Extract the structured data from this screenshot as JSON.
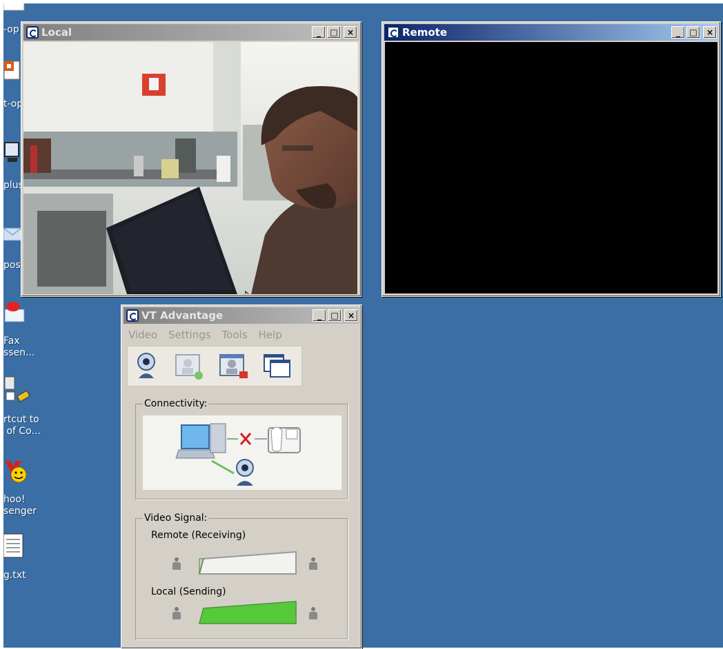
{
  "desktop": {
    "icons": [
      {
        "id": "doc",
        "label": "-op"
      },
      {
        "id": "ppt",
        "label": "t-op"
      },
      {
        "id": "monitor",
        "label": "plus"
      },
      {
        "id": "mail",
        "label": "pose"
      },
      {
        "id": "fax",
        "label": "Fax\nssen..."
      },
      {
        "id": "shortcut",
        "label": "rtcut to\n of Co..."
      },
      {
        "id": "yahoo",
        "label": "hoo!\nsenger"
      },
      {
        "id": "txt",
        "label": "g.txt"
      }
    ]
  },
  "local_window": {
    "title": "Local",
    "buttons": {
      "min": "_",
      "max": "□",
      "close": "×"
    }
  },
  "remote_window": {
    "title": "Remote",
    "buttons": {
      "min": "_",
      "max": "□",
      "close": "×"
    }
  },
  "vt_window": {
    "title": "VT Advantage",
    "buttons": {
      "min": "_",
      "max": "□",
      "close": "×"
    },
    "menu": [
      "Video",
      "Settings",
      "Tools",
      "Help"
    ],
    "toolbar": [
      "camera-icon",
      "add-video-icon",
      "stop-video-icon",
      "windows-icon"
    ],
    "connectivity": {
      "legend": "Connectivity:",
      "status_icons": [
        "computer-icon",
        "disconnected-x-icon",
        "ip-phone-icon",
        "camera-icon"
      ]
    },
    "video_signal": {
      "legend": "Video Signal:",
      "remote_label": "Remote (Receiving)",
      "local_label": "Local (Sending)",
      "remote_level": 0,
      "local_level": 1
    }
  },
  "colors": {
    "desktop": "#3a6ea5",
    "signal_active": "#56c93a",
    "signal_idle": "#e6e6e6",
    "disconnect": "#d22020"
  }
}
